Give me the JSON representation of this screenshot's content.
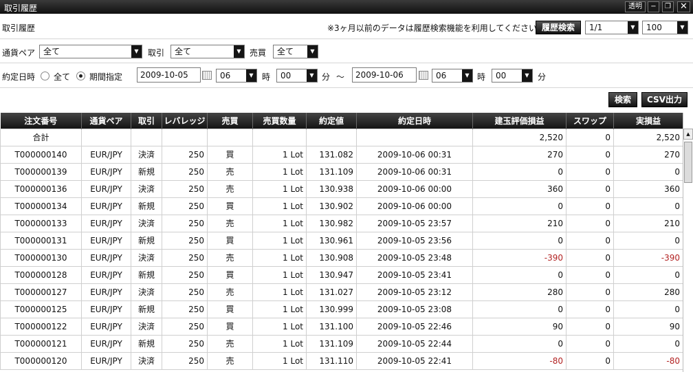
{
  "window": {
    "title": "取引履歴",
    "transparent_label": "透明",
    "minimize_glyph": "−",
    "restore_glyph": "❐",
    "close_glyph": "✕"
  },
  "header": {
    "page_title": "取引履歴",
    "notice": "※3ヶ月以前のデータは履歴検索機能を利用してください。",
    "history_search_label": "履歴検索",
    "page_select": "1/1",
    "per_page_select": "100"
  },
  "filters": {
    "pair_label": "通貨ペア",
    "pair_value": "全て",
    "trade_label": "取引",
    "trade_value": "全て",
    "side_label": "売買",
    "side_value": "全て"
  },
  "date": {
    "label": "約定日時",
    "all_label": "全て",
    "range_label": "期間指定",
    "from_date": "2009-10-05",
    "from_hour": "06",
    "from_min": "00",
    "to_date": "2009-10-06",
    "to_hour": "06",
    "to_min": "00",
    "hour_unit": "時",
    "min_unit": "分",
    "tilde": "～"
  },
  "actions": {
    "search_label": "検索",
    "csv_label": "CSV出力"
  },
  "table": {
    "columns": [
      "注文番号",
      "通貨ペア",
      "取引",
      "レバレッジ",
      "売買",
      "売買数量",
      "約定値",
      "約定日時",
      "建玉評価損益",
      "スワップ",
      "実損益"
    ],
    "total": {
      "label": "合計",
      "eval": "2,520",
      "swap": "0",
      "pnl": "2,520"
    },
    "rows": [
      {
        "id": "T000000140",
        "pair": "EUR/JPY",
        "trade": "決済",
        "lev": "250",
        "side": "買",
        "qty": "1 Lot",
        "price": "131.082",
        "time": "2009-10-06 00:31",
        "eval": "270",
        "swap": "0",
        "pnl": "270"
      },
      {
        "id": "T000000139",
        "pair": "EUR/JPY",
        "trade": "新規",
        "lev": "250",
        "side": "売",
        "qty": "1 Lot",
        "price": "131.109",
        "time": "2009-10-06 00:31",
        "eval": "0",
        "swap": "0",
        "pnl": "0"
      },
      {
        "id": "T000000136",
        "pair": "EUR/JPY",
        "trade": "決済",
        "lev": "250",
        "side": "売",
        "qty": "1 Lot",
        "price": "130.938",
        "time": "2009-10-06 00:00",
        "eval": "360",
        "swap": "0",
        "pnl": "360"
      },
      {
        "id": "T000000134",
        "pair": "EUR/JPY",
        "trade": "新規",
        "lev": "250",
        "side": "買",
        "qty": "1 Lot",
        "price": "130.902",
        "time": "2009-10-06 00:00",
        "eval": "0",
        "swap": "0",
        "pnl": "0"
      },
      {
        "id": "T000000133",
        "pair": "EUR/JPY",
        "trade": "決済",
        "lev": "250",
        "side": "売",
        "qty": "1 Lot",
        "price": "130.982",
        "time": "2009-10-05 23:57",
        "eval": "210",
        "swap": "0",
        "pnl": "210"
      },
      {
        "id": "T000000131",
        "pair": "EUR/JPY",
        "trade": "新規",
        "lev": "250",
        "side": "買",
        "qty": "1 Lot",
        "price": "130.961",
        "time": "2009-10-05 23:56",
        "eval": "0",
        "swap": "0",
        "pnl": "0"
      },
      {
        "id": "T000000130",
        "pair": "EUR/JPY",
        "trade": "決済",
        "lev": "250",
        "side": "売",
        "qty": "1 Lot",
        "price": "130.908",
        "time": "2009-10-05 23:48",
        "eval": "-390",
        "swap": "0",
        "pnl": "-390"
      },
      {
        "id": "T000000128",
        "pair": "EUR/JPY",
        "trade": "新規",
        "lev": "250",
        "side": "買",
        "qty": "1 Lot",
        "price": "130.947",
        "time": "2009-10-05 23:41",
        "eval": "0",
        "swap": "0",
        "pnl": "0"
      },
      {
        "id": "T000000127",
        "pair": "EUR/JPY",
        "trade": "決済",
        "lev": "250",
        "side": "売",
        "qty": "1 Lot",
        "price": "131.027",
        "time": "2009-10-05 23:12",
        "eval": "280",
        "swap": "0",
        "pnl": "280"
      },
      {
        "id": "T000000125",
        "pair": "EUR/JPY",
        "trade": "新規",
        "lev": "250",
        "side": "買",
        "qty": "1 Lot",
        "price": "130.999",
        "time": "2009-10-05 23:08",
        "eval": "0",
        "swap": "0",
        "pnl": "0"
      },
      {
        "id": "T000000122",
        "pair": "EUR/JPY",
        "trade": "決済",
        "lev": "250",
        "side": "買",
        "qty": "1 Lot",
        "price": "131.100",
        "time": "2009-10-05 22:46",
        "eval": "90",
        "swap": "0",
        "pnl": "90"
      },
      {
        "id": "T000000121",
        "pair": "EUR/JPY",
        "trade": "新規",
        "lev": "250",
        "side": "売",
        "qty": "1 Lot",
        "price": "131.109",
        "time": "2009-10-05 22:44",
        "eval": "0",
        "swap": "0",
        "pnl": "0"
      },
      {
        "id": "T000000120",
        "pair": "EUR/JPY",
        "trade": "決済",
        "lev": "250",
        "side": "売",
        "qty": "1 Lot",
        "price": "131.110",
        "time": "2009-10-05 22:41",
        "eval": "-80",
        "swap": "0",
        "pnl": "-80"
      }
    ]
  },
  "colors": {
    "negative": "#b22222",
    "header_bg": "#1a1a1a"
  }
}
